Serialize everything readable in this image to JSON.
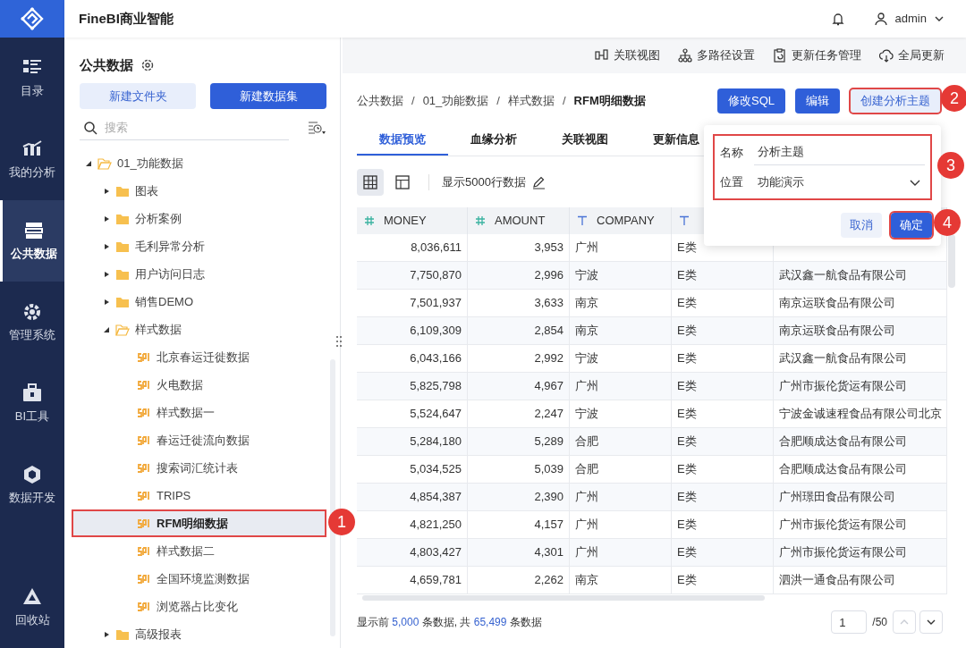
{
  "app": {
    "title": "FineBI商业智能",
    "user": "admin"
  },
  "nav": [
    {
      "label": "目录",
      "selected": false
    },
    {
      "label": "我的分析",
      "selected": false
    },
    {
      "label": "公共数据",
      "selected": true
    },
    {
      "label": "管理系统",
      "selected": false
    },
    {
      "label": "BI工具",
      "selected": false
    },
    {
      "label": "数据开发",
      "selected": false
    },
    {
      "label": "回收站",
      "selected": false
    }
  ],
  "panel": {
    "title": "公共数据",
    "buttons": [
      {
        "label": "新建文件夹",
        "kind": "secondary"
      },
      {
        "label": "新建数据集",
        "kind": "primary"
      }
    ],
    "search": {
      "placeholder": "搜索"
    }
  },
  "tree": [
    {
      "label": "01_功能数据",
      "kind": "folder",
      "expanded": true,
      "selected": false,
      "children": [
        {
          "label": "图表",
          "kind": "folder",
          "expanded": false,
          "selected": false
        },
        {
          "label": "分析案例",
          "kind": "folder",
          "expanded": false,
          "selected": false
        },
        {
          "label": "毛利异常分析",
          "kind": "folder",
          "expanded": false,
          "selected": false
        },
        {
          "label": "用户访问日志",
          "kind": "folder",
          "expanded": false,
          "selected": false
        },
        {
          "label": "销售DEMO",
          "kind": "folder",
          "expanded": false,
          "selected": false
        },
        {
          "label": "样式数据",
          "kind": "folder",
          "expanded": true,
          "selected": false,
          "children": [
            {
              "label": "北京春运迁徙数据",
              "kind": "sql",
              "selected": false
            },
            {
              "label": "火电数据",
              "kind": "sql",
              "selected": false
            },
            {
              "label": "样式数据一",
              "kind": "sql",
              "selected": false
            },
            {
              "label": "春运迁徙流向数据",
              "kind": "sql",
              "selected": false
            },
            {
              "label": "搜索词汇统计表",
              "kind": "sql",
              "selected": false
            },
            {
              "label": "TRIPS",
              "kind": "sql",
              "selected": false
            },
            {
              "label": "RFM明细数据",
              "kind": "sql",
              "selected": true
            },
            {
              "label": "样式数据二",
              "kind": "sql",
              "selected": false
            },
            {
              "label": "全国环境监测数据",
              "kind": "sql",
              "selected": false
            },
            {
              "label": "浏览器占比变化",
              "kind": "sql",
              "selected": false
            }
          ]
        },
        {
          "label": "高级报表",
          "kind": "folder",
          "expanded": false,
          "selected": false
        }
      ]
    }
  ],
  "toolbar": [
    "关联视图",
    "多路径设置",
    "更新任务管理",
    "全局更新"
  ],
  "breadcrumb": [
    {
      "label": "公共数据",
      "kind": "link"
    },
    {
      "label": "/",
      "kind": "separator"
    },
    {
      "label": "01_功能数据",
      "kind": "link"
    },
    {
      "label": "/",
      "kind": "separator"
    },
    {
      "label": "样式数据",
      "kind": "link"
    },
    {
      "label": "/",
      "kind": "separator"
    },
    {
      "label": "RFM明细数据",
      "kind": "current"
    }
  ],
  "actions": [
    {
      "label": "修改SQL",
      "kind": "primary"
    },
    {
      "label": "编辑",
      "kind": "primary"
    },
    {
      "label": "创建分析主题",
      "kind": "secondary"
    }
  ],
  "tabs": [
    {
      "label": "数据预览",
      "selected": true
    },
    {
      "label": "血缘分析",
      "selected": false
    },
    {
      "label": "关联视图",
      "selected": false
    },
    {
      "label": "更新信息",
      "selected": false
    }
  ],
  "view": {
    "modes": [
      {
        "selected": true
      },
      {
        "selected": false
      }
    ],
    "rows_label": "显示5000行数据"
  },
  "table": {
    "columns": [
      {
        "label": "MONEY",
        "kind": "number"
      },
      {
        "label": "AMOUNT",
        "kind": "number"
      },
      {
        "label": "COMPANY",
        "kind": "text"
      },
      {
        "kind": "text"
      }
    ],
    "rows": [
      [
        "8,036,611",
        "3,953",
        "广州",
        "E类"
      ],
      [
        "7,750,870",
        "2,996",
        "宁波",
        "E类",
        "武汉鑫一航食品有限公司"
      ],
      [
        "7,501,937",
        "3,633",
        "南京",
        "E类",
        "南京运联食品有限公司"
      ],
      [
        "6,109,309",
        "2,854",
        "南京",
        "E类",
        "南京运联食品有限公司"
      ],
      [
        "6,043,166",
        "2,992",
        "宁波",
        "E类",
        "武汉鑫一航食品有限公司"
      ],
      [
        "5,825,798",
        "4,967",
        "广州",
        "E类",
        "广州市振伦货运有限公司"
      ],
      [
        "5,524,647",
        "2,247",
        "宁波",
        "E类",
        "宁波金诚速程食品有限公司北京"
      ],
      [
        "5,284,180",
        "5,289",
        "合肥",
        "E类",
        "合肥顺成达食品有限公司"
      ],
      [
        "5,034,525",
        "5,039",
        "合肥",
        "E类",
        "合肥顺成达食品有限公司"
      ],
      [
        "4,854,387",
        "2,390",
        "广州",
        "E类",
        "广州璟田食品有限公司"
      ],
      [
        "4,821,250",
        "4,157",
        "广州",
        "E类",
        "广州市振伦货运有限公司"
      ],
      [
        "4,803,427",
        "4,301",
        "广州",
        "E类",
        "广州市振伦货运有限公司"
      ],
      [
        "4,659,781",
        "2,262",
        "南京",
        "E类",
        "泗洪一通食品有限公司"
      ]
    ]
  },
  "footer": {
    "summary": "显示前 **5,000** 条数据, 共 **65,499** 条数据",
    "page": "1",
    "pages": "/50",
    "prev_disabled": true,
    "next_disabled": false
  },
  "popup": {
    "fields": [
      {
        "label": "名称",
        "value": "分析主题",
        "kind": "input"
      },
      {
        "label": "位置",
        "value": "功能演示",
        "kind": "select"
      }
    ],
    "buttons": [
      {
        "label": "取消",
        "kind": "secondary"
      },
      {
        "label": "确定",
        "kind": "primary"
      }
    ]
  },
  "annotations": [
    "1",
    "2",
    "3",
    "4"
  ]
}
